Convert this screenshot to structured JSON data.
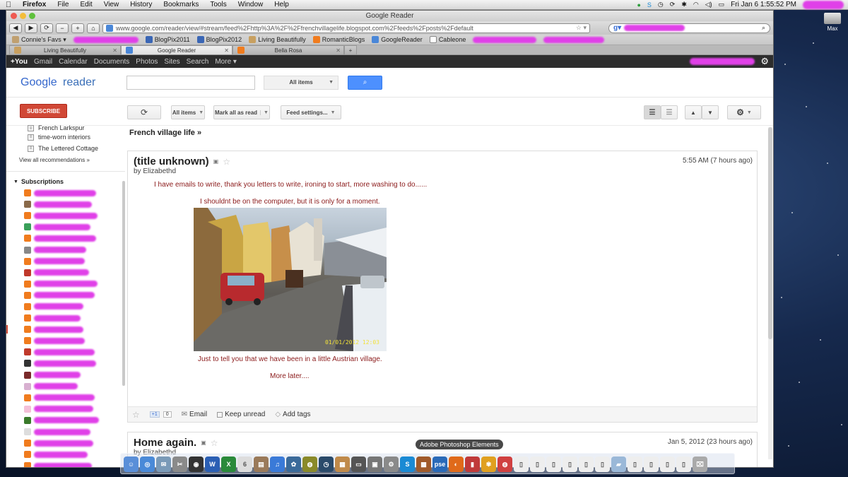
{
  "menubar": {
    "app": "Firefox",
    "items": [
      "File",
      "Edit",
      "View",
      "History",
      "Bookmarks",
      "Tools",
      "Window",
      "Help"
    ],
    "clock": "Fri Jan 6  1:55:52 PM"
  },
  "window": {
    "title": "Google Reader",
    "url": "www.google.com/reader/view/#stream/feed%2Fhttp%3A%2F%2Ffrenchvillagelife.blogspot.com%2Ffeeds%2Fposts%2Fdefault"
  },
  "bookmarks": [
    {
      "label": "Connie's Favs ▾",
      "icon": "folder"
    },
    {
      "label": "BlogPix2011",
      "icon": "pix"
    },
    {
      "label": "BlogPix2012",
      "icon": "pix"
    },
    {
      "label": "Living Beautifully",
      "icon": "lb"
    },
    {
      "label": "RomanticBlogs",
      "icon": "blog"
    },
    {
      "label": "GoogleReader",
      "icon": "gr"
    },
    {
      "label": "Cableone",
      "icon": "doc"
    }
  ],
  "tabs": [
    {
      "label": "Living Beautifully",
      "active": false
    },
    {
      "label": "Google Reader",
      "active": true
    },
    {
      "label": "Bella Rosa",
      "active": false
    }
  ],
  "gbar": {
    "items": [
      "+You",
      "Gmail",
      "Calendar",
      "Documents",
      "Photos",
      "Sites",
      "Search",
      "More ▾"
    ]
  },
  "reader": {
    "logo_google": "Google",
    "logo_reader": "reader",
    "search_scope": "All items",
    "subscribe_label": "SUBSCRIBE",
    "toolbar": {
      "refresh": "⟳",
      "all_items": "All items",
      "mark_all_read": "Mark all as read",
      "feed_settings": "Feed settings..."
    }
  },
  "sidebar": {
    "feeds": [
      "French Larkspur",
      "time-worn interiors",
      "The Lettered Cottage"
    ],
    "view_all": "View all recommendations »",
    "subscriptions_label": "Subscriptions"
  },
  "main": {
    "folder_title": "French village life »",
    "entries": [
      {
        "title": "(title unknown)",
        "author": "by Elizabethd",
        "time": "5:55 AM (7 hours ago)",
        "paragraphs": [
          "I have emails to write, thank you letters to write, ironing to start, more washing to do......",
          "I shouldnt be on the computer, but it is only for a moment.",
          "Just to tell you that we have been in a little Austrian village.",
          "More later...."
        ],
        "photo_date": "01/01/2012 12:03",
        "actions": {
          "plusone": "+1",
          "plusone_count": "0",
          "email": "Email",
          "keep_unread": "Keep unread",
          "add_tags": "Add tags"
        }
      },
      {
        "title": "Home again.",
        "author": "by Elizabethd",
        "time": "Jan 5, 2012 (23 hours ago)"
      }
    ]
  },
  "dock": {
    "tooltip": "Adobe Photoshop Elements"
  },
  "desktop": {
    "drive_label": "Max"
  }
}
